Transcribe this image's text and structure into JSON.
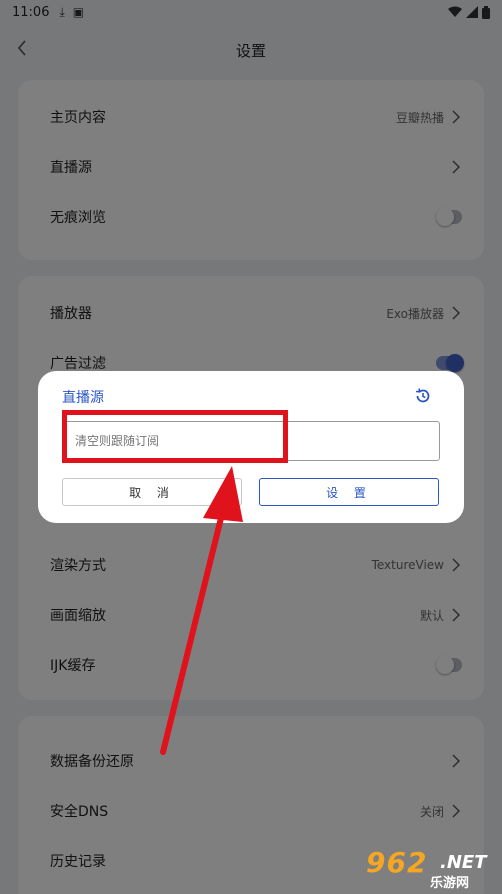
{
  "status_bar": {
    "time": "11:06",
    "download_icon": "download-icon",
    "app_icon": "app-icon",
    "wifi_icon": "wifi-icon",
    "signal_icon": "signal-icon",
    "battery_icon": "battery-icon"
  },
  "header": {
    "title": "设置",
    "back_icon": "chevron-left-icon"
  },
  "section1": {
    "items": [
      {
        "label": "主页内容",
        "value": "豆瓣热播"
      },
      {
        "label": "直播源",
        "value": ""
      },
      {
        "label": "无痕浏览",
        "toggle": false
      }
    ]
  },
  "section2": {
    "items": [
      {
        "label": "播放器",
        "value": "Exo播放器"
      },
      {
        "label": "广告过滤",
        "toggle": true
      },
      {
        "label": "渲染方式",
        "value": "TextureView"
      },
      {
        "label": "画面缩放",
        "value": "默认"
      },
      {
        "label": "IJK缓存",
        "toggle": false
      }
    ]
  },
  "section3": {
    "items": [
      {
        "label": "数据备份还原",
        "value": ""
      },
      {
        "label": "安全DNS",
        "value": "关闭"
      },
      {
        "label": "历史记录",
        "value": ""
      }
    ]
  },
  "dialog": {
    "title": "直播源",
    "history_icon": "history-icon",
    "input_placeholder": "清空则跟随订阅",
    "cancel_label": "取 消",
    "ok_label": "设 置"
  },
  "colors": {
    "accent": "#2a56c6",
    "annotation": "#e0121c",
    "background": "#eef0f4"
  },
  "watermark": {
    "logo": "962",
    "domain": ".NET",
    "sub": "乐游网"
  }
}
